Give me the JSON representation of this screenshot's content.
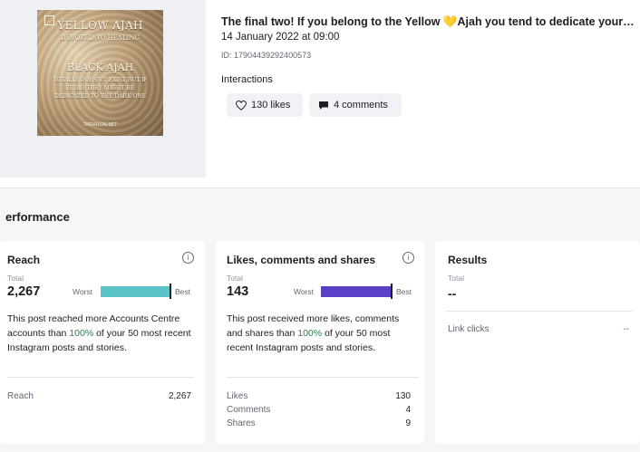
{
  "post": {
    "thumbnail": {
      "line1": "YELLOW AJAH",
      "line2": "DEVOTED TO HEALING",
      "line3": "BLACK AJAH",
      "line4": "TOTALLY DOESN'T EXIST BUT IF IT DID THEY MIGHT BE DEDICATED TO THE DARK ONE",
      "logo_text": "TARVALON.NET"
    },
    "title_before": "The final two! If you belong to the Yellow ",
    "title_heart": "💛",
    "title_after": "Ajah you tend to dedicate yoursel...",
    "date": "14 January 2022 at 09:00",
    "id": "ID: 17904439292400573",
    "interactions_label": "Interactions",
    "likes_chip": "130 likes",
    "comments_chip": "4 comments"
  },
  "performance": {
    "title": "erformance",
    "reach": {
      "title": "Reach",
      "total_label": "Total",
      "total_value": "2,267",
      "worst_label": "Worst",
      "best_label": "Best",
      "bar_fraction": 1.0,
      "bar_color": "#5bc4c9",
      "desc_before": "This post reached more Accounts Centre accounts than ",
      "desc_pct": "100%",
      "desc_after": " of your 50 most recent Instagram posts and stories.",
      "rows": [
        {
          "label": "Reach",
          "value": "2,267"
        }
      ]
    },
    "engagement": {
      "title": "Likes, comments and shares",
      "total_label": "Total",
      "total_value": "143",
      "worst_label": "Worst",
      "best_label": "Best",
      "bar_fraction": 1.0,
      "bar_color": "#5b3fc7",
      "desc_before": "This post received more likes, comments and shares than ",
      "desc_pct": "100%",
      "desc_after": " of your 50 most recent Instagram posts and stories.",
      "rows": [
        {
          "label": "Likes",
          "value": "130"
        },
        {
          "label": "Comments",
          "value": "4"
        },
        {
          "label": "Shares",
          "value": "9"
        }
      ]
    },
    "results": {
      "title": "Results",
      "total_label": "Total",
      "total_value": "--",
      "rows": [
        {
          "label": "Link clicks",
          "value": "--"
        }
      ]
    }
  },
  "icons": {
    "info": "info-icon",
    "heart": "heart-outline-icon",
    "comment": "comment-bubble-icon"
  },
  "colors": {
    "percent_text": "#2e7d4f"
  }
}
